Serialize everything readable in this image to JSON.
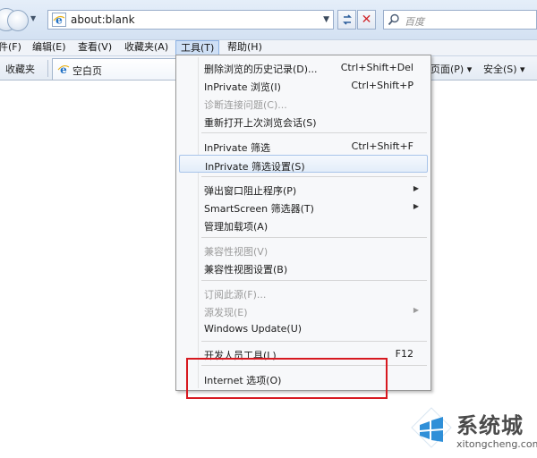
{
  "address_bar": {
    "url": "about:blank",
    "search_placeholder": "百度"
  },
  "menu_bar": [
    "件(F)",
    "编辑(E)",
    "查看(V)",
    "收藏夹(A)",
    "工具(T)",
    "帮助(H)"
  ],
  "favorites_bar": {
    "favorites_label": "收藏夹",
    "tab_label": "空白页",
    "page_menu": "页面(P) ▾",
    "security_menu": "安全(S) ▾"
  },
  "tools_menu": {
    "items": [
      {
        "label": "删除浏览的历史记录(D)...",
        "shortcut": "Ctrl+Shift+Del"
      },
      {
        "label": "InPrivate 浏览(I)",
        "shortcut": "Ctrl+Shift+P"
      },
      {
        "label": "诊断连接问题(C)...",
        "disabled": true
      },
      {
        "label": "重新打开上次浏览会话(S)"
      },
      {
        "label": "InPrivate 筛选",
        "shortcut": "Ctrl+Shift+F"
      },
      {
        "label": "InPrivate 筛选设置(S)",
        "highlighted": true
      },
      {
        "label": "弹出窗口阻止程序(P)",
        "submenu": true
      },
      {
        "label": "SmartScreen 筛选器(T)",
        "submenu": true
      },
      {
        "label": "管理加载项(A)"
      },
      {
        "label": "兼容性视图(V)",
        "disabled": true
      },
      {
        "label": "兼容性视图设置(B)"
      },
      {
        "label": "订阅此源(F)...",
        "disabled": true
      },
      {
        "label": "源发现(E)",
        "disabled": true,
        "submenu": true
      },
      {
        "label": "Windows Update(U)"
      },
      {
        "label": "开发人员工具(L)",
        "shortcut": "F12"
      },
      {
        "label": "Internet 选项(O)"
      }
    ]
  },
  "watermark": {
    "brand": "系统城",
    "url": "xitongcheng.com"
  },
  "colors": {
    "annotation_red": "#d71920",
    "menu_highlight": "#e3edf9"
  }
}
